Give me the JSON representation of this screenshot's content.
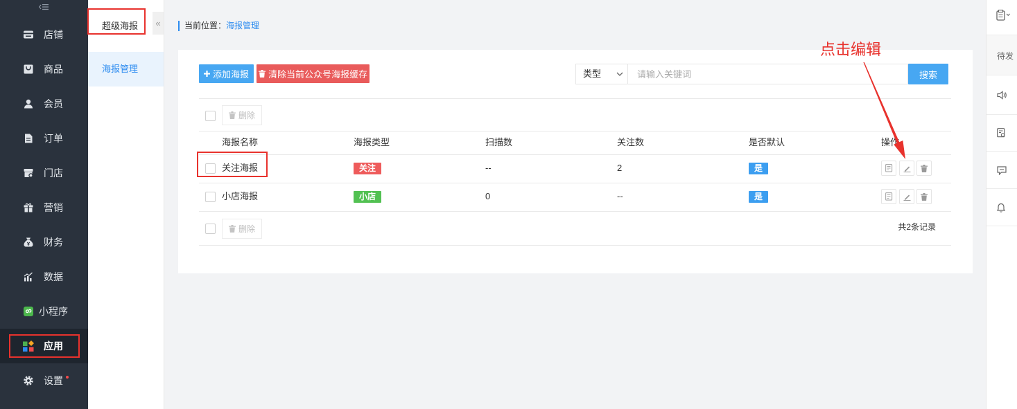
{
  "sidebar": {
    "collapse_icon": "menu-collapse-icon",
    "items": [
      {
        "label": "店铺",
        "icon": "store-icon"
      },
      {
        "label": "商品",
        "icon": "goods-icon"
      },
      {
        "label": "会员",
        "icon": "member-icon"
      },
      {
        "label": "订单",
        "icon": "order-icon"
      },
      {
        "label": "门店",
        "icon": "shop-icon"
      },
      {
        "label": "营销",
        "icon": "gift-icon"
      },
      {
        "label": "财务",
        "icon": "finance-icon"
      },
      {
        "label": "数据",
        "icon": "chart-icon"
      },
      {
        "label": "小程序",
        "icon": "mini-program-icon"
      },
      {
        "label": "应用",
        "icon": "apps-icon",
        "active": true
      },
      {
        "label": "设置",
        "icon": "gear-icon",
        "has_dot": true
      }
    ]
  },
  "subnav": {
    "title": "超级海报",
    "collapse_glyph": "«",
    "items": [
      {
        "label": "海报管理",
        "active": true
      }
    ]
  },
  "breadcrumb": {
    "prefix": "当前位置：",
    "current": "海报管理"
  },
  "toolbar": {
    "add_label": "添加海报",
    "clear_cache_label": "清除当前公众号海报缓存"
  },
  "search": {
    "type_select": "类型",
    "placeholder": "请输入关键词",
    "button_label": "搜索"
  },
  "bulk_actions": {
    "delete_label": "删除"
  },
  "table": {
    "columns": [
      "海报名称",
      "海报类型",
      "扫描数",
      "关注数",
      "是否默认",
      "操作"
    ],
    "rows": [
      {
        "name": "关注海报",
        "type": "关注",
        "type_color": "#ee5b5b",
        "scans": "--",
        "follows": "2",
        "is_default": "是",
        "actions": [
          "preview-icon",
          "edit-icon",
          "delete-icon"
        ]
      },
      {
        "name": "小店海报",
        "type": "小店",
        "type_color": "#52c152",
        "scans": "0",
        "follows": "--",
        "is_default": "是",
        "actions": [
          "preview-icon",
          "edit-icon",
          "delete-icon"
        ]
      }
    ]
  },
  "pagination": {
    "total_text": "共2条记录"
  },
  "annotation": {
    "text": "点击编辑",
    "color": "#e8322d"
  },
  "right_panel": {
    "pending_label": "待发",
    "icons": [
      "clipboard-icon",
      "speaker-icon",
      "document-icon",
      "chat-icon",
      "bell-icon"
    ]
  },
  "colors": {
    "sidebar_bg": "#2a323d",
    "sidebar_active_bg": "#1e252e",
    "primary": "#47a7f2",
    "danger": "#e95b5b",
    "default_badge": "#3c9ef0",
    "link": "#2d8cf0",
    "dot": "#f34a4a"
  }
}
